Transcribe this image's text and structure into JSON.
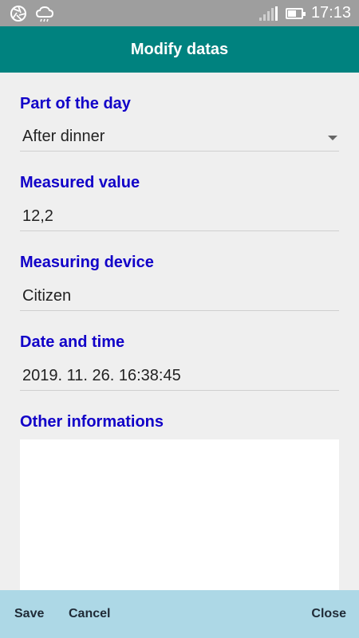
{
  "status_bar": {
    "time": "17:13",
    "icons": [
      "aperture-icon",
      "weather-cloud-icon",
      "signal-icon",
      "battery-icon"
    ],
    "battery_level": 0.6
  },
  "title": "Modify datas",
  "form": {
    "part_of_day": {
      "label": "Part of the day",
      "value": "After dinner"
    },
    "measured_value": {
      "label": "Measured value",
      "value": "12,2"
    },
    "measuring_device": {
      "label": "Measuring device",
      "value": "Citizen"
    },
    "date_time": {
      "label": "Date and time",
      "value": "2019. 11. 26. 16:38:45"
    },
    "other_info": {
      "label": "Other informations",
      "value": ""
    }
  },
  "actions": {
    "save": "Save",
    "cancel": "Cancel",
    "close": "Close"
  },
  "colors": {
    "statusbar": "#9e9e9e",
    "titlebar": "#00827f",
    "label": "#1100c8",
    "actionbar": "#add8e6",
    "background": "#efefef"
  }
}
